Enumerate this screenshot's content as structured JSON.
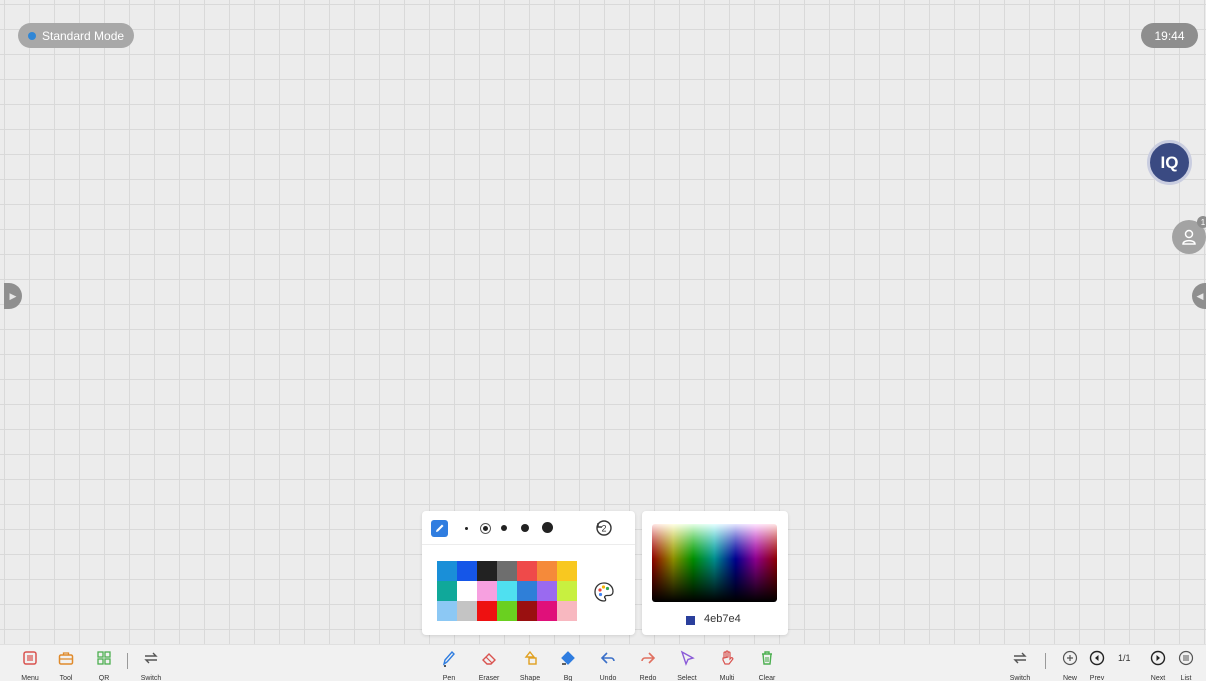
{
  "mode": {
    "label": "Standard Mode",
    "dot_color": "#2f86d6"
  },
  "clock": "19:44",
  "iq_badge": {
    "text": "IQ",
    "icon": "iq-logo-icon"
  },
  "user": {
    "count": "1",
    "icon": "user-icon"
  },
  "pen_panel": {
    "pen_icon": "pen-icon",
    "reset_icon": "reset-icon",
    "palette_icon": "palette-icon",
    "stroke_sizes": [
      "xs",
      "s",
      "m",
      "l",
      "xl"
    ],
    "selected_size": "s",
    "swatches": [
      "#1a8fd8",
      "#1556e8",
      "#222222",
      "#6e6e6e",
      "#ef4a4a",
      "#f58a3a",
      "#f8c820",
      "#10a89a",
      "#ffffff",
      "#f7a0e0",
      "#4fe0f0",
      "#2f7fd8",
      "#9a6af0",
      "#c8f040",
      "#8cc8f4",
      "#c4c4c4",
      "#ee1111",
      "#6ad020",
      "#9a1010",
      "#e0107a",
      "#f8b8c0"
    ]
  },
  "picker": {
    "hex": "4eb7e4",
    "swatch_color": "#2a3f9c"
  },
  "toolbar": {
    "left": [
      {
        "label": "Menu",
        "icon": "menu-icon",
        "color": "#d9534f"
      },
      {
        "label": "Tool",
        "icon": "toolbox-icon",
        "color": "#e08a2a"
      },
      {
        "label": "QR",
        "icon": "qr-grid-icon",
        "color": "#4caf50"
      },
      {
        "label": "Switch",
        "icon": "switch-icon",
        "color": "#555555"
      }
    ],
    "center": [
      {
        "label": "Pen",
        "icon": "pen-icon",
        "color": "#2f7de0"
      },
      {
        "label": "Eraser",
        "icon": "eraser-icon",
        "color": "#d9534f"
      },
      {
        "label": "Shape",
        "icon": "shape-icon",
        "color": "#e0a020"
      },
      {
        "label": "Bg",
        "icon": "fill-icon",
        "color": "#2f7de0"
      },
      {
        "label": "Undo",
        "icon": "undo-icon",
        "color": "#3a6fc8"
      },
      {
        "label": "Redo",
        "icon": "redo-icon",
        "color": "#e07060"
      },
      {
        "label": "Select",
        "icon": "select-icon",
        "color": "#8a5ad8"
      },
      {
        "label": "Multi",
        "icon": "multi-touch-icon",
        "color": "#d9534f"
      },
      {
        "label": "Clear",
        "icon": "trash-icon",
        "color": "#4caf50"
      }
    ],
    "right": [
      {
        "label": "Switch",
        "icon": "switch-icon",
        "color": "#555555"
      },
      {
        "label": "New",
        "icon": "plus-circle-icon",
        "color": "#555555"
      },
      {
        "label": "Prev",
        "icon": "prev-circle-icon",
        "color": "#222222"
      },
      {
        "label": "Next",
        "icon": "next-circle-icon",
        "color": "#222222"
      },
      {
        "label": "List",
        "icon": "list-circle-icon",
        "color": "#555555"
      }
    ],
    "page": "1/1"
  }
}
